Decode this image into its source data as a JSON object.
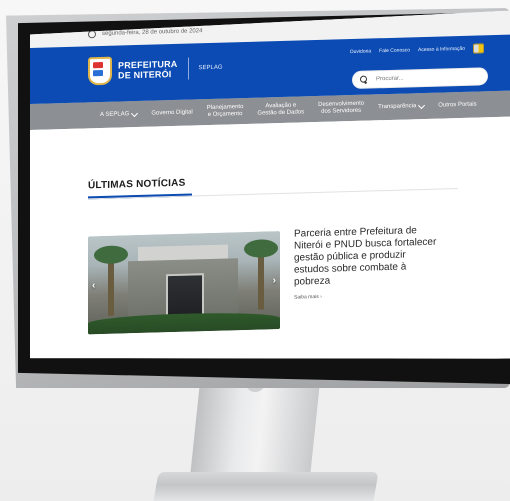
{
  "topbar": {
    "date": "segunda-feira, 28 de outubro de 2024"
  },
  "header": {
    "brand_line1": "PREFEITURA",
    "brand_line2": "DE NITERÓI",
    "org": "SEPLAG"
  },
  "util_links": [
    "Ouvidoria",
    "Fale Conosco",
    "Acesso à Informação"
  ],
  "search": {
    "placeholder": "Procurar..."
  },
  "nav": {
    "items": [
      {
        "label": "A SEPLAG",
        "has_dropdown": true
      },
      {
        "label": "Governo Digital"
      },
      {
        "label_line1": "Planejamento",
        "label_line2": "e Orçamento"
      },
      {
        "label_line1": "Avaliação e",
        "label_line2": "Gestão de Dados"
      },
      {
        "label_line1": "Desenvolvimento",
        "label_line2": "dos Servidores"
      },
      {
        "label": "Transparência",
        "has_dropdown": true
      },
      {
        "label": "Outros Portais"
      }
    ]
  },
  "section": {
    "title": "ÚLTIMAS NOTÍCIAS"
  },
  "news": {
    "headline": "Parceria entre Prefeitura de Niterói e PNUD busca fortalecer gestão pública e produzir estudos sobre combate à pobreza",
    "read_more": "Saiba mais ›",
    "photo_sign": "ANTIGO CENTRO TECNOLÓGICO"
  },
  "carousel": {
    "prev": "‹",
    "next": "›"
  },
  "icons": {
    "clock": "clock-icon",
    "search": "search-icon",
    "chevron": "chevron-down-icon",
    "flag": "language-flag-icon",
    "crest": "city-crest-icon"
  },
  "colors": {
    "brand_blue": "#0b4bb3",
    "nav_gray": "#8c8f93",
    "topbar_gray": "#f2f2f2"
  }
}
